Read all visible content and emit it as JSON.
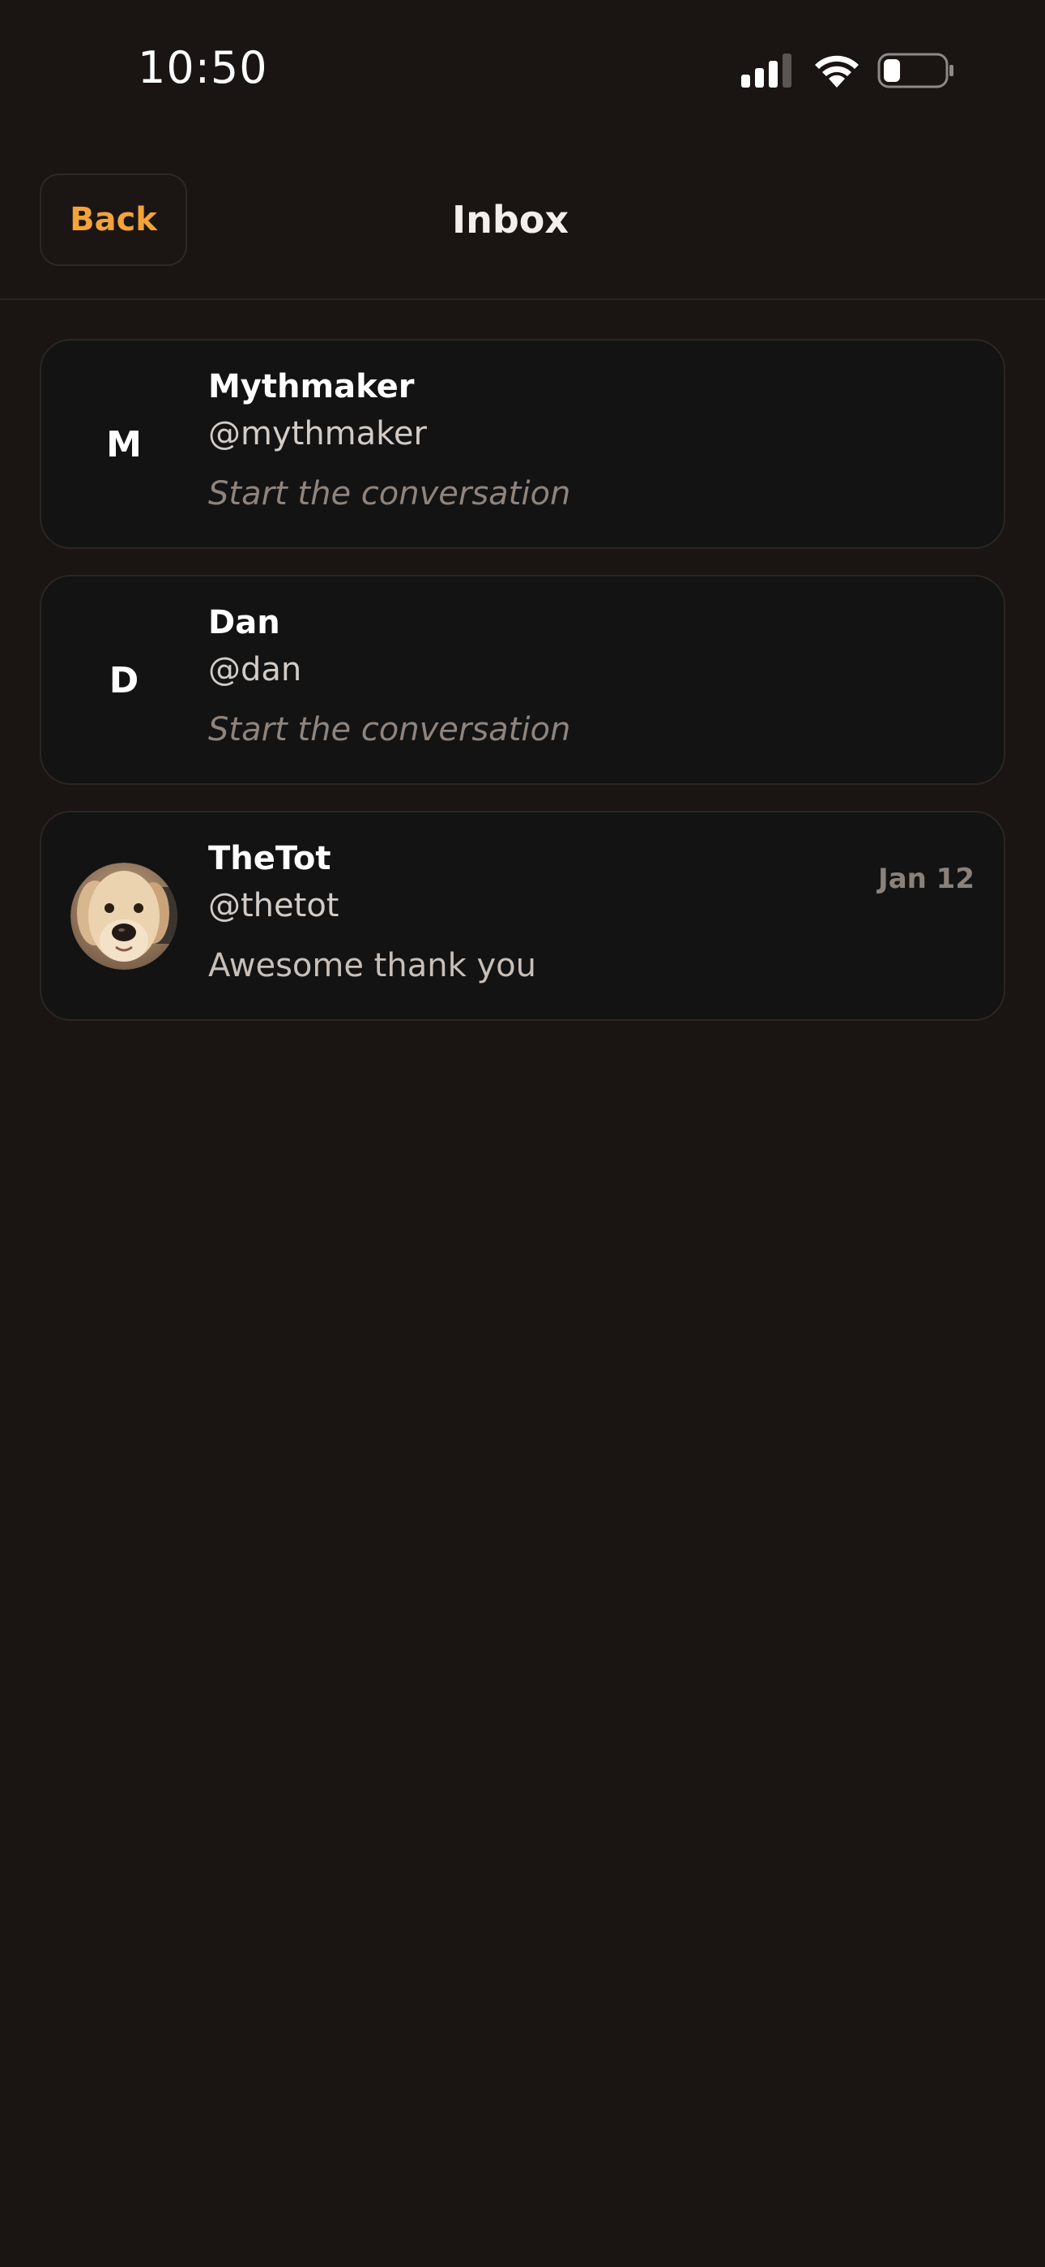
{
  "status_bar": {
    "time": "10:50"
  },
  "nav": {
    "back_label": "Back",
    "title": "Inbox"
  },
  "conversations": [
    {
      "avatar_initial": "M",
      "name": "Mythmaker",
      "handle": "@mythmaker",
      "preview": "Start the conversation",
      "date": ""
    },
    {
      "avatar_initial": "D",
      "name": "Dan",
      "handle": "@dan",
      "preview": "Start the conversation",
      "date": ""
    },
    {
      "avatar_initial": "",
      "avatar_image": "dog-photo",
      "name": "TheTot",
      "handle": "@thetot",
      "preview": "Awesome thank you",
      "date": "Jan 12"
    }
  ],
  "colors": {
    "background": "#1a1512",
    "card": "#131313",
    "accent": "#f2a33a"
  }
}
